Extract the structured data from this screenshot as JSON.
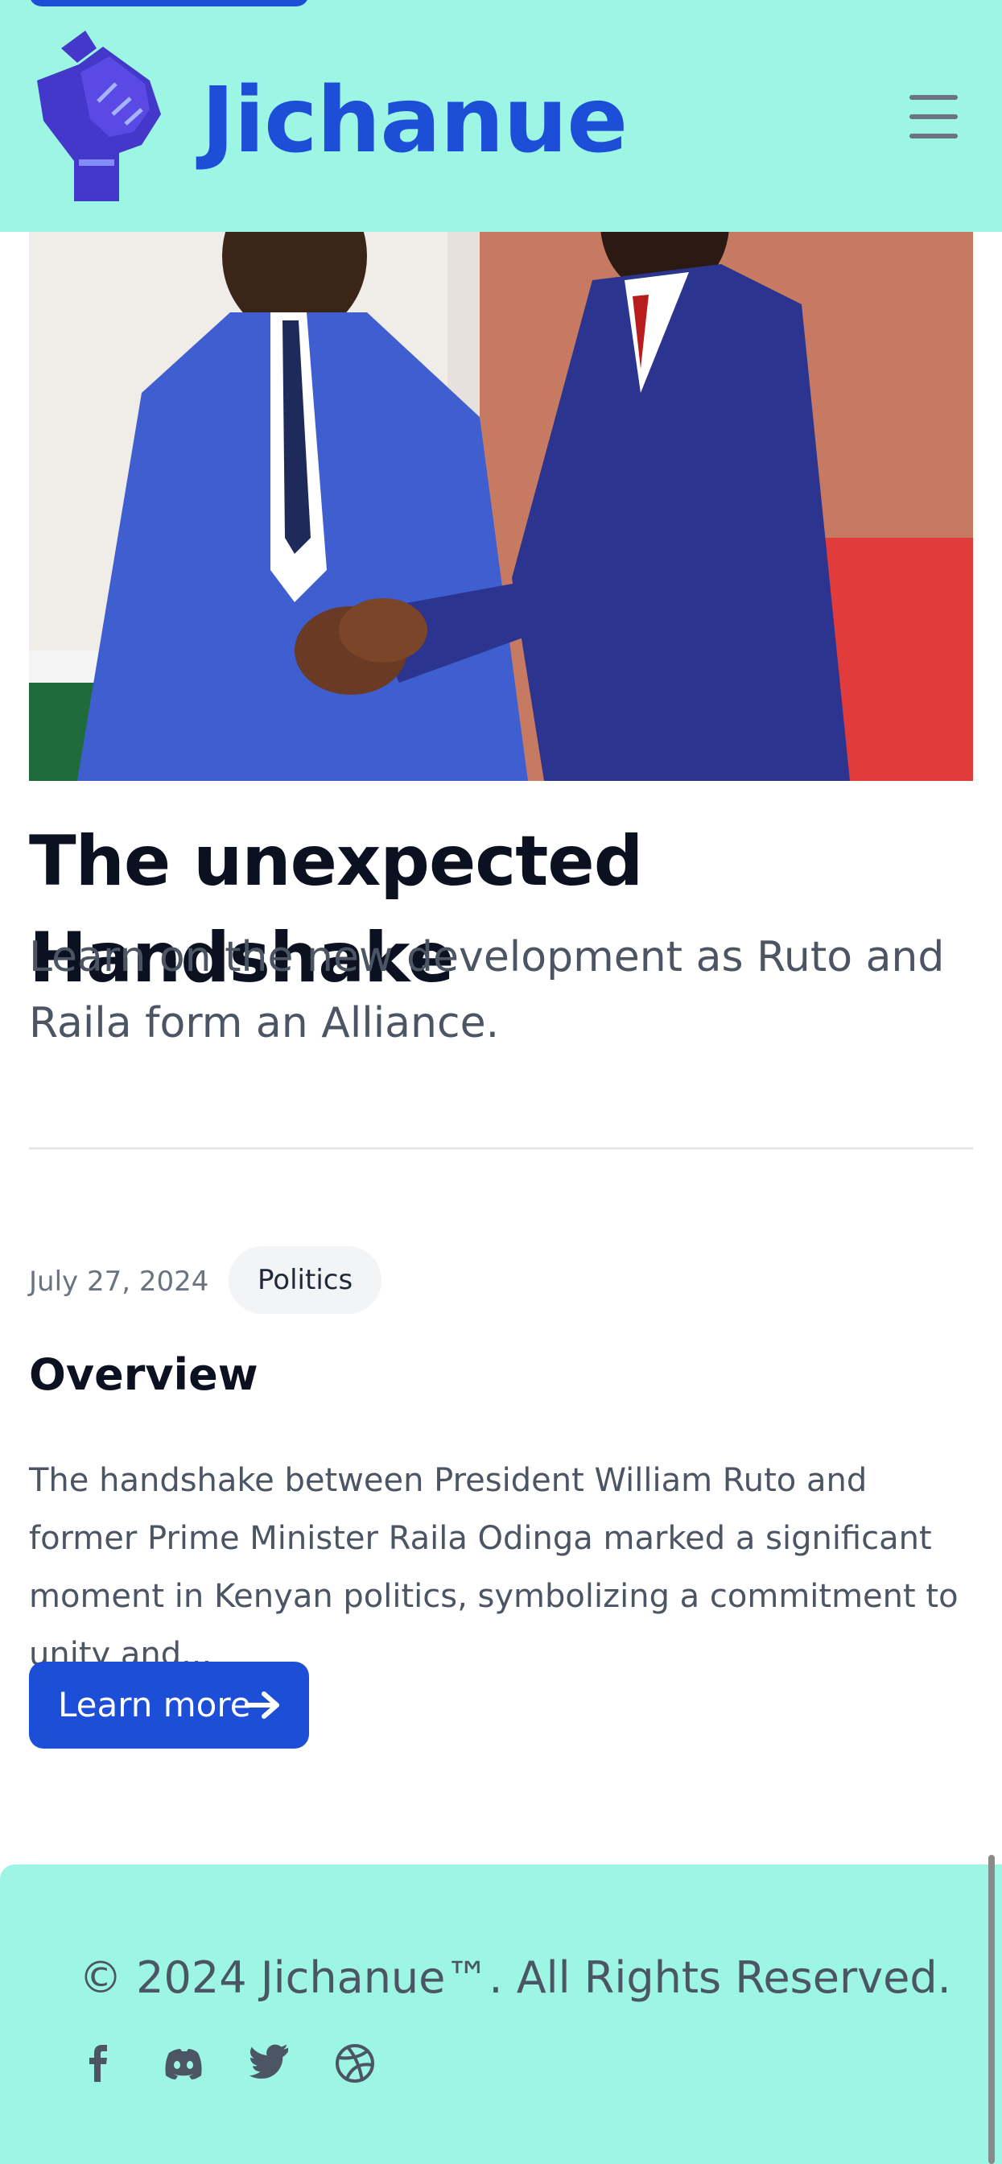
{
  "header": {
    "brand": "Jichanue",
    "logo_icon": "raised-fist-icon",
    "menu_icon": "hamburger-menu-icon",
    "background": "#9df5e3",
    "brand_color": "#1d4ed8"
  },
  "article": {
    "title": "The unexpected Handshake",
    "subtitle": "Learn on the new development as Ruto and Raila form an Alliance.",
    "date": "July 27, 2024",
    "category": "Politics",
    "section_heading": "Overview",
    "excerpt": "The handshake between President William Ruto and former Prime Minister Raila Odinga marked a significant moment in Kenyan politics, symbolizing a commitment to unity and...",
    "cta_label": "Learn more",
    "cta_icon": "arrow-right-icon"
  },
  "footer": {
    "copyright": "© 2024 Jichanue™. All Rights Reserved.",
    "social_icons": [
      "facebook-icon",
      "discord-icon",
      "twitter-icon",
      "dribbble-icon"
    ]
  }
}
